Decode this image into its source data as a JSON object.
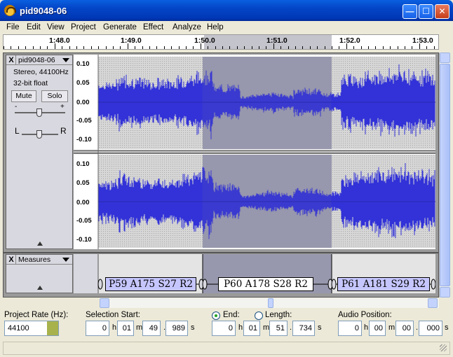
{
  "window": {
    "title": "pid9048-06",
    "min_glyph": "—",
    "max_glyph": "☐",
    "close_glyph": "✕"
  },
  "menu": [
    "File",
    "Edit",
    "View",
    "Project",
    "Generate",
    "Effect",
    "Analyze",
    "Help"
  ],
  "ruler": {
    "labels": [
      "1:48.0",
      "1:49.0",
      "1:50.0",
      "1:51.0",
      "1:52.0",
      "1:53.0"
    ]
  },
  "track": {
    "close": "X",
    "name": "pid9048-06",
    "format": "Stereo, 44100Hz",
    "bits": "32-bit float",
    "mute": "Mute",
    "solo": "Solo",
    "gain_minus": "-",
    "gain_plus": "+",
    "pan_left": "L",
    "pan_right": "R",
    "scale_top": [
      "0.10",
      "0.05",
      "0.00",
      "-0.05",
      "-0.10"
    ],
    "scale_bottom": [
      "0.10",
      "0.05",
      "0.00",
      "-0.05",
      "-0.10"
    ]
  },
  "labeltrack": {
    "close": "X",
    "name": "Measures",
    "labels": [
      "P59 A175 S27 R2",
      "P60 A178 S28 R2",
      "P61 A181 S29 R2"
    ]
  },
  "bottom": {
    "rate_label": "Project Rate (Hz):",
    "rate_value": "44100",
    "selection_start_label": "Selection Start:",
    "end_label": "End:",
    "length_label": "Length:",
    "audio_position_label": "Audio Position:",
    "start": {
      "h": "0",
      "m": "01",
      "s": "49",
      "ms": "989"
    },
    "end": {
      "h": "0",
      "m": "01",
      "s": "51",
      "ms": "734"
    },
    "position": {
      "h": "0",
      "m": "00",
      "s": "00",
      "ms": "000"
    },
    "unit_h": "h",
    "unit_m": "m",
    "unit_s": "s"
  }
}
